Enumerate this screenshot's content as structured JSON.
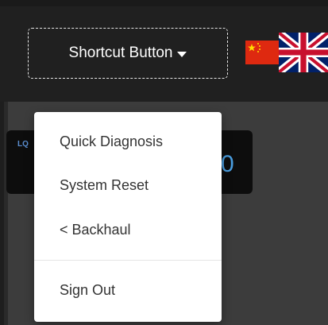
{
  "header": {
    "shortcut_button_label": "Shortcut Button",
    "languages": [
      "Chinese",
      "English (UK)"
    ]
  },
  "background": {
    "card_value_fragment": "0",
    "card_icon_text": "LQ"
  },
  "menu": {
    "items": [
      {
        "label": "Quick Diagnosis"
      },
      {
        "label": "System Reset"
      },
      {
        "label": "< Backhaul"
      }
    ],
    "sign_out_label": "Sign Out"
  },
  "colors": {
    "topbar": "#202020",
    "body": "#3c3c3c",
    "accent": "#4a9ee0",
    "menu_text": "#333333"
  }
}
